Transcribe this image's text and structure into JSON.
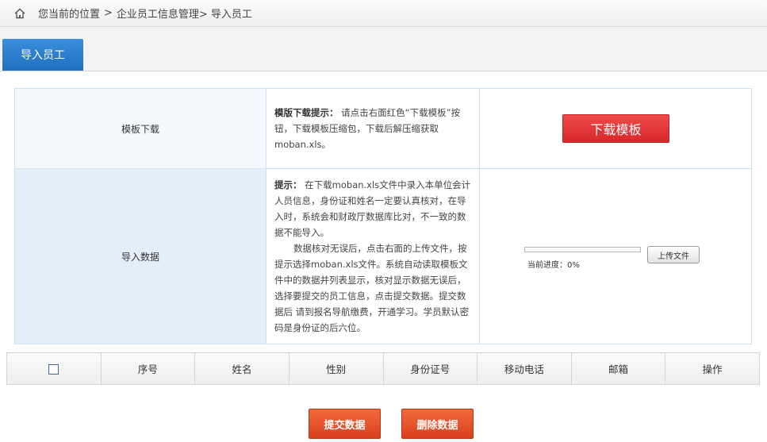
{
  "breadcrumb": {
    "home_icon": "home-icon",
    "prefix": "您当前的位置",
    "sep1": ">",
    "level1": "企业员工信息管理>",
    "level2": "导入员工"
  },
  "tabs": {
    "active_label": "导入员工"
  },
  "template_row": {
    "label": "模板下载",
    "tip_title": "模版下载提示：",
    "tip_body": "请点击右面红色“下载模板”按钮，下载模板压缩包，下载后解压缩获取moban.xls。",
    "download_label": "下载模板"
  },
  "import_row": {
    "label": "导入数据",
    "tip_title": "提示：",
    "tip_para1": "在下载moban.xls文件中录入本单位会计人员信息，身份证和姓名一定要认真核对，在导入时，系统会和财政厅数据库比对，不一致的数据不能导入。",
    "tip_para2": "数据核对无误后，点击右面的上传文件，按提示选择moban.xls文件。系统自动读取模板文件中的数据并列表显示，核对显示数据无误后，选择要提交的员工信息，点击提交数据。提交数据后 请到报名导航缴费，开通学习。学员默认密码是身份证的后六位。",
    "progress_label": "当前进度：0%",
    "progress_fraction": 0,
    "upload_label": "上传文件"
  },
  "table": {
    "columns": [
      "序号",
      "姓名",
      "性别",
      "身份证号",
      "移动电话",
      "邮箱",
      "操作"
    ]
  },
  "actions": {
    "submit_label": "提交数据",
    "delete_label": "删除数据"
  },
  "colors": {
    "tab_active": "#2a7fd0",
    "download_button": "#e03235",
    "action_button": "#e4522b"
  }
}
